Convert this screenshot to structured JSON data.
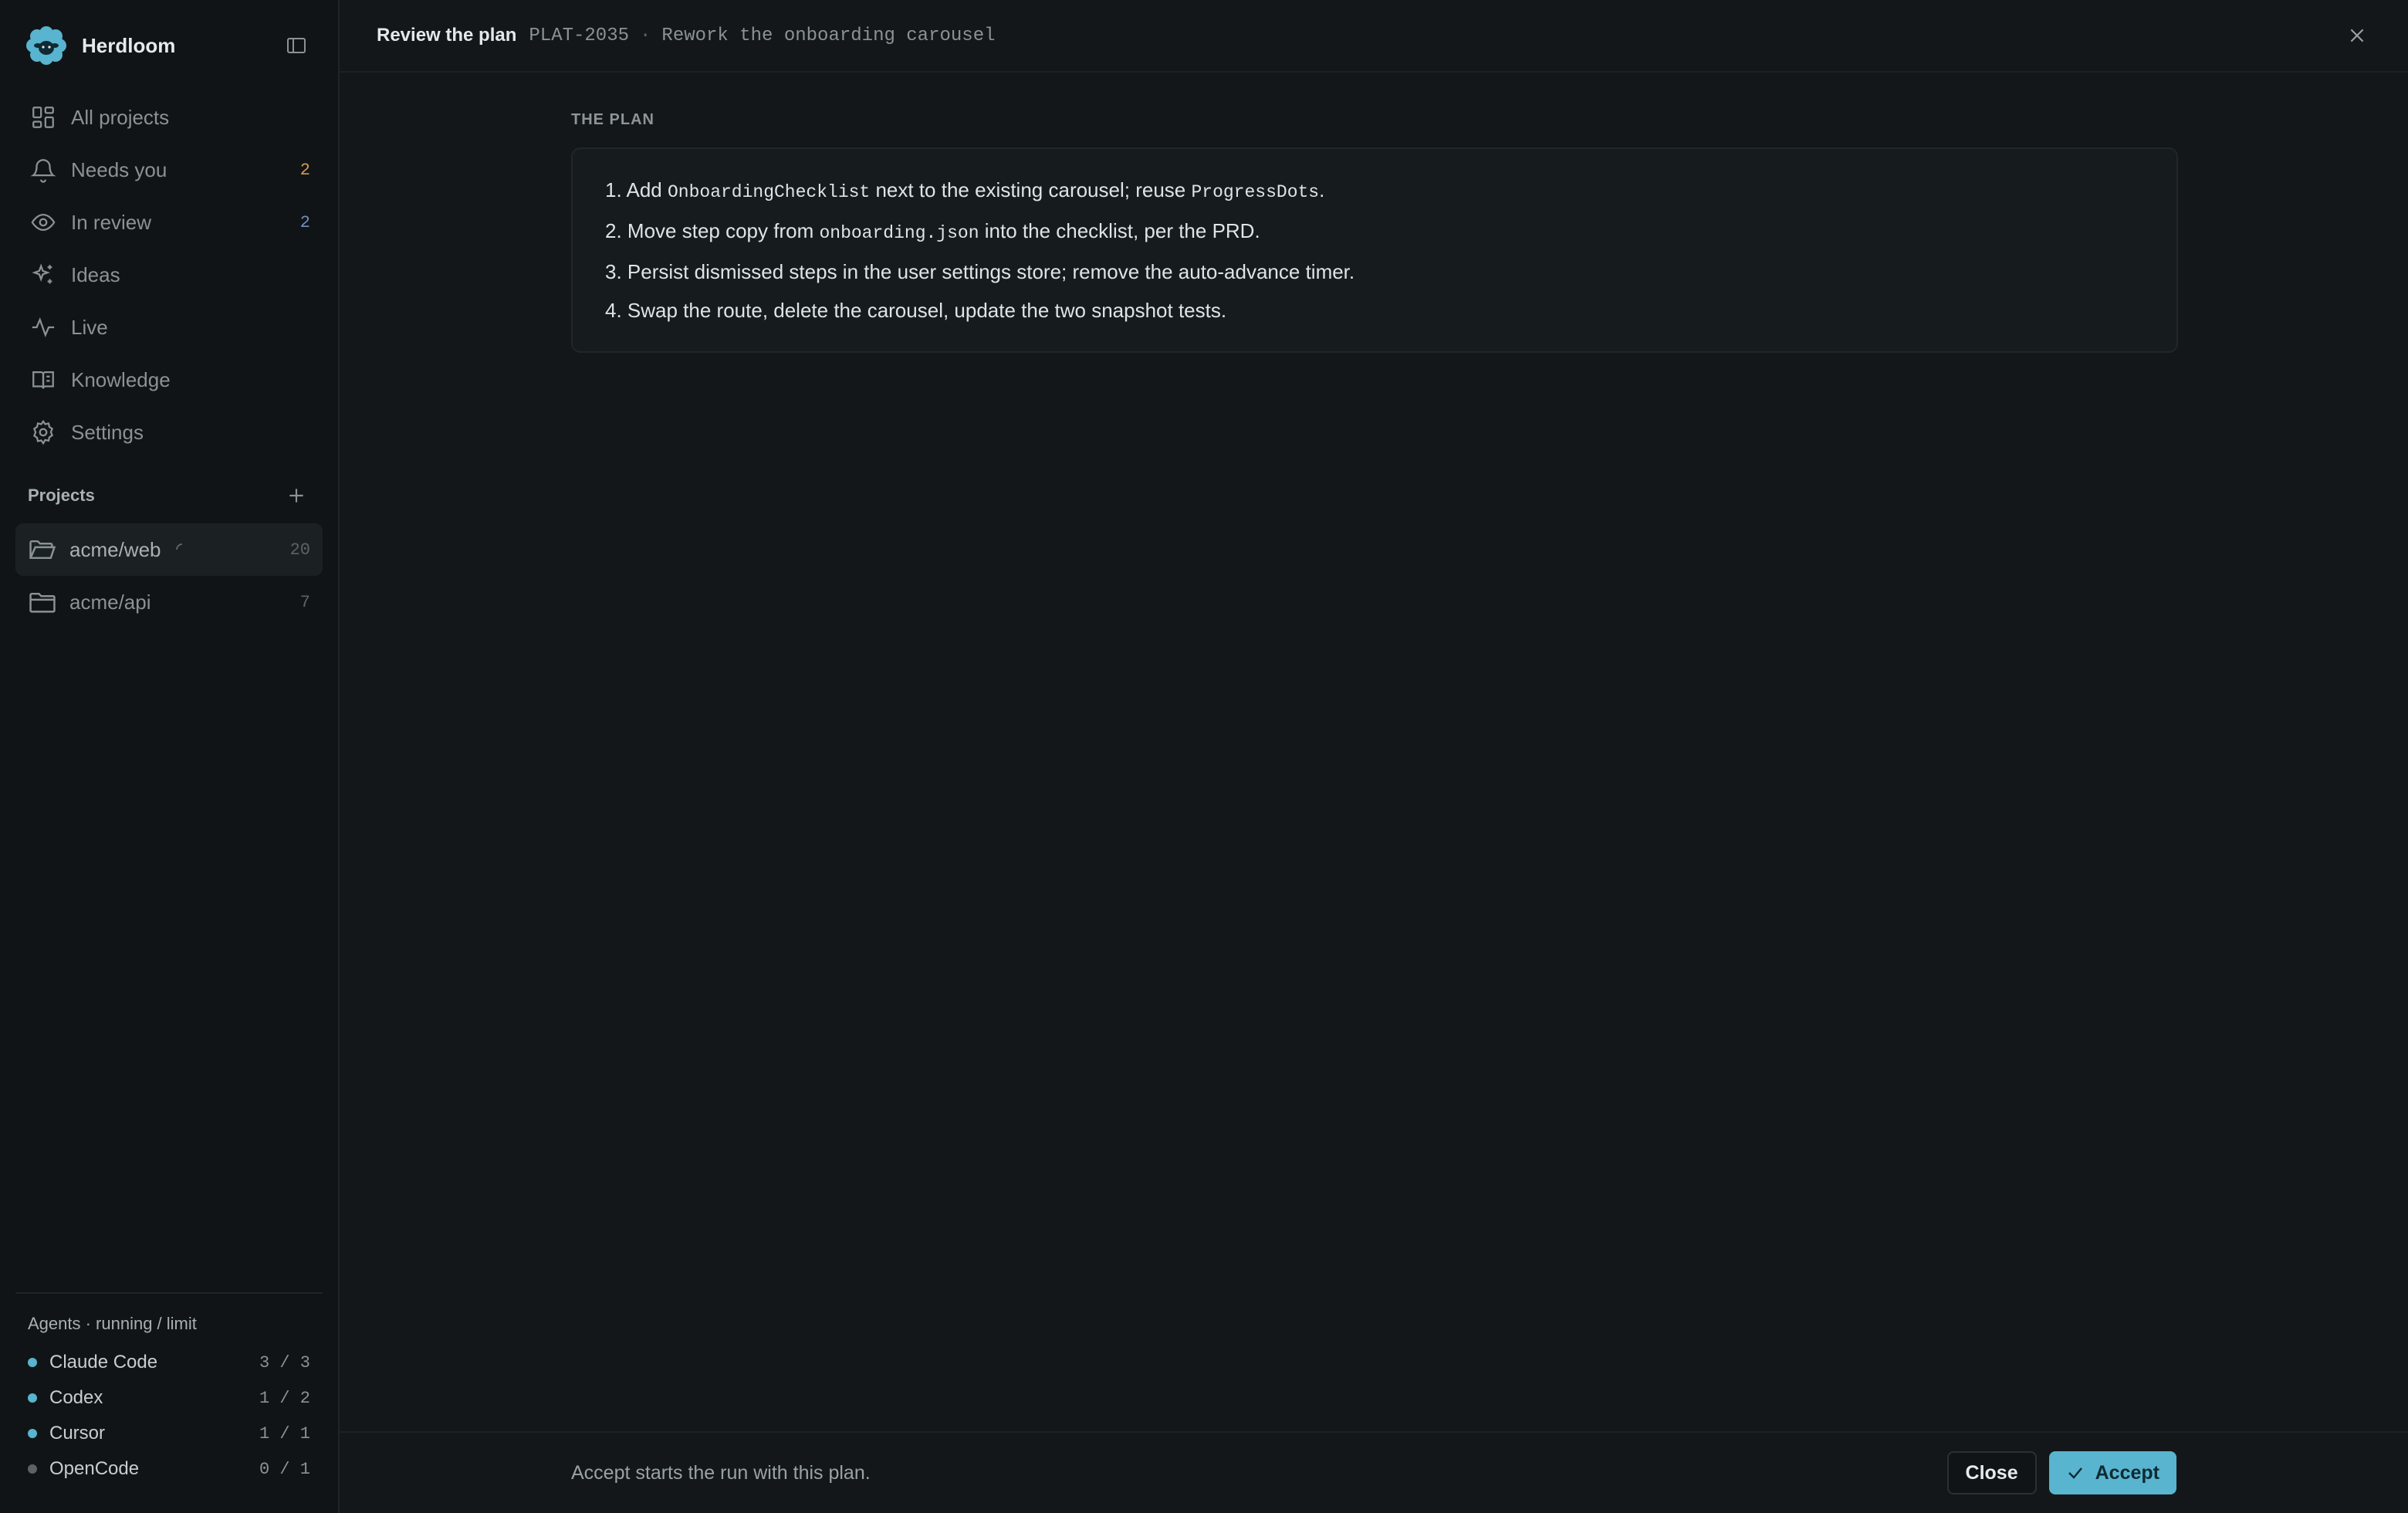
{
  "brand": {
    "name": "Herdloom"
  },
  "nav": [
    {
      "label": "All projects",
      "icon": "grid-icon",
      "count": ""
    },
    {
      "label": "Needs you",
      "icon": "bell-icon",
      "count": "2"
    },
    {
      "label": "In review",
      "icon": "eye-icon",
      "count": "2"
    },
    {
      "label": "Ideas",
      "icon": "sparkle-icon",
      "count": ""
    },
    {
      "label": "Live",
      "icon": "activity-icon",
      "count": ""
    },
    {
      "label": "Knowledge",
      "icon": "book-icon",
      "count": ""
    },
    {
      "label": "Settings",
      "icon": "gear-icon",
      "count": ""
    }
  ],
  "projects": {
    "title": "Projects",
    "items": [
      {
        "label": "acme/web",
        "count": "20",
        "active": true,
        "loading": true
      },
      {
        "label": "acme/api",
        "count": "7",
        "active": false,
        "loading": false
      }
    ]
  },
  "agents": {
    "title": "Agents · running / limit",
    "items": [
      {
        "name": "Claude Code",
        "count": "3 / 3",
        "color": "#58b4cf"
      },
      {
        "name": "Codex",
        "count": "1 / 2",
        "color": "#58b4cf"
      },
      {
        "name": "Cursor",
        "count": "1 / 1",
        "color": "#58b4cf"
      },
      {
        "name": "OpenCode",
        "count": "0 / 1",
        "color": "#5b6367"
      }
    ]
  },
  "header": {
    "title": "Review the plan",
    "ticket": "PLAT-2035",
    "separator": "·",
    "description": "Rework the onboarding carousel"
  },
  "plan": {
    "label": "THE PLAN",
    "steps": [
      {
        "num": "1.",
        "parts": [
          "Add ",
          "OnboardingChecklist",
          " next to the existing carousel; reuse ",
          "ProgressDots",
          "."
        ]
      },
      {
        "num": "2.",
        "parts": [
          "Move step copy from ",
          "onboarding.json",
          " into the checklist, per the PRD."
        ]
      },
      {
        "num": "3.",
        "parts": [
          "Persist dismissed steps in the user settings store; remove the auto-advance timer."
        ]
      },
      {
        "num": "4.",
        "parts": [
          "Swap the route, delete the carousel, update the two snapshot tests."
        ]
      }
    ]
  },
  "footer": {
    "note": "Accept starts the run with this plan.",
    "close_label": "Close",
    "accept_label": "Accept"
  },
  "colors": {
    "accent": "#58b4cf",
    "background": "#131719",
    "sidebar": "#111416"
  }
}
